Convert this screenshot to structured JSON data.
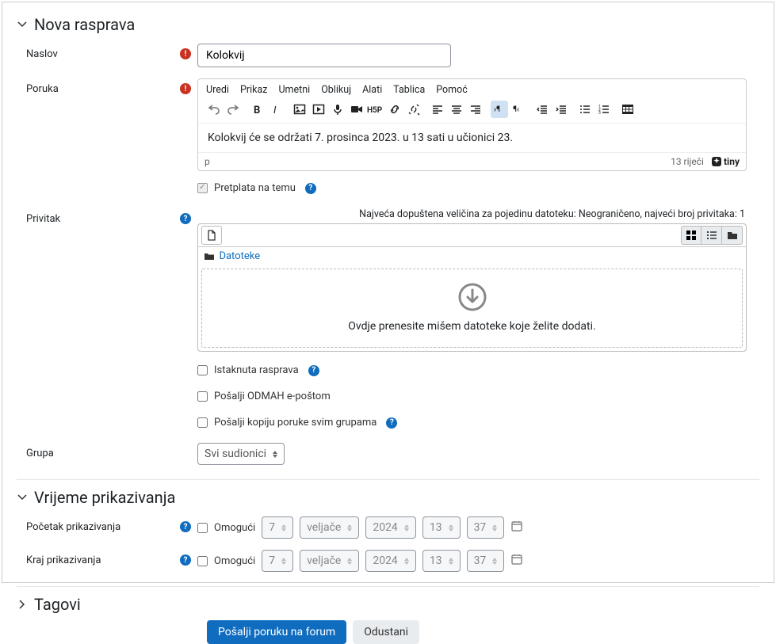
{
  "sections": {
    "nova": "Nova rasprava",
    "vrijeme": "Vrijeme prikazivanja",
    "tagovi": "Tagovi"
  },
  "form": {
    "naslov_label": "Naslov",
    "naslov_value": "Kolokvij",
    "poruka_label": "Poruka",
    "privitak_label": "Privitak",
    "grupa_label": "Grupa",
    "pocetak_label": "Početak prikazivanja",
    "kraj_label": "Kraj prikazivanja"
  },
  "editor": {
    "menus": [
      "Uredi",
      "Prikaz",
      "Umetni",
      "Oblikuj",
      "Alati",
      "Tablica",
      "Pomoć"
    ],
    "content": "Kolokvij će se održati 7. prosinca 2023. u 13 sati u učionici 23.",
    "path": "p",
    "words": "13 riječi",
    "brand": "tiny"
  },
  "checks": {
    "pretplata": "Pretplata na temu",
    "istaknuta": "Istaknuta rasprava",
    "odmah": "Pošalji ODMAH e-poštom",
    "kopija": "Pošalji kopiju poruke svim grupama"
  },
  "attach": {
    "info": "Najveća dopuštena veličina za pojedinu datoteku: Neograničeno, najveći broj privitaka: 1",
    "path": "Datoteke",
    "drop": "Ovdje prenesite mišem datoteke koje želite dodati."
  },
  "grupa": {
    "selected": "Svi sudionici"
  },
  "time": {
    "enable": "Omogući",
    "day": "7",
    "month": "veljače",
    "year": "2024",
    "hour": "13",
    "min": "37"
  },
  "actions": {
    "submit": "Pošalji poruku na forum",
    "cancel": "Odustani"
  }
}
